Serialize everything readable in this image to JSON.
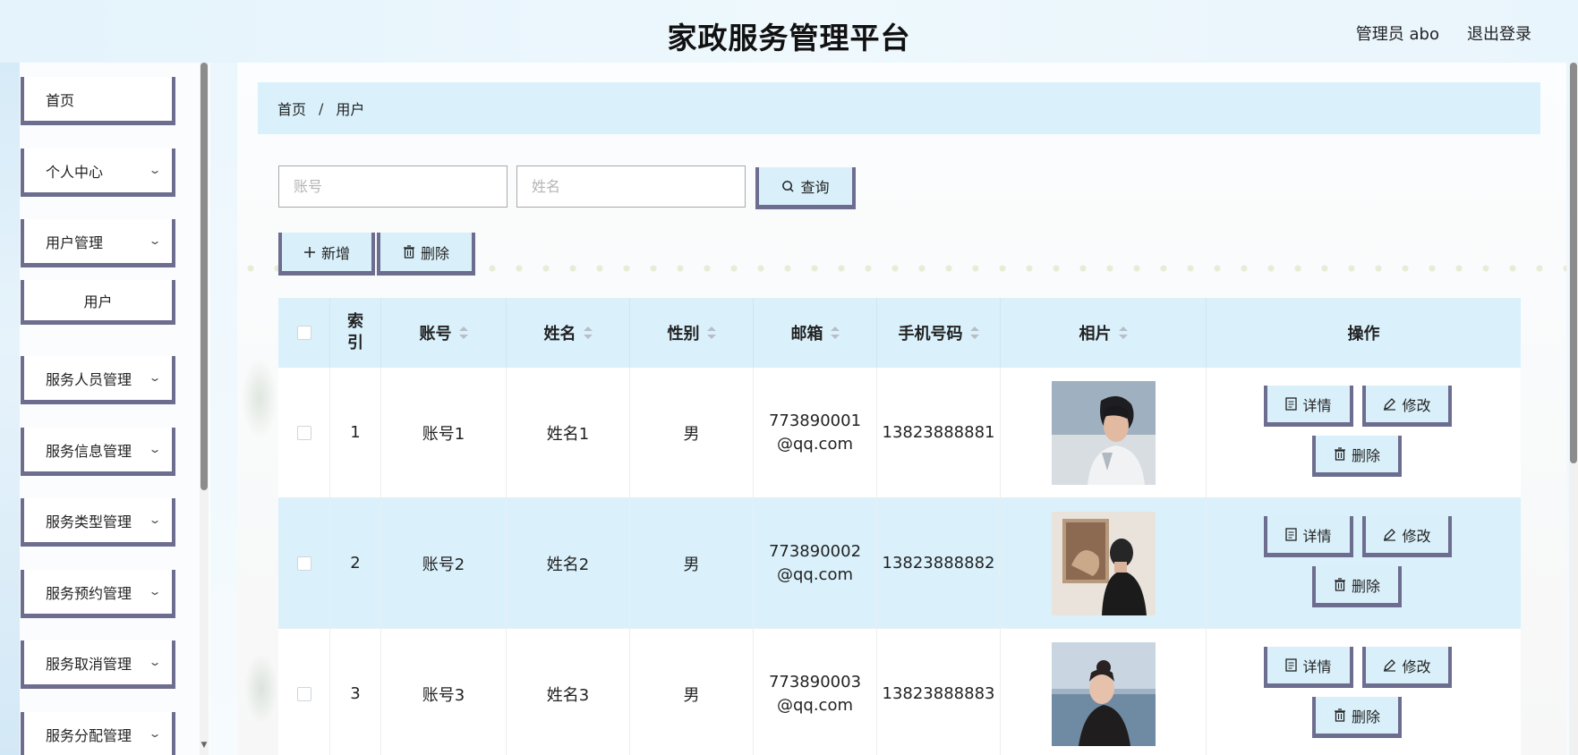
{
  "header": {
    "title": "家政服务管理平台",
    "user": "管理员 abo",
    "logout": "退出登录"
  },
  "sidebar": {
    "items": [
      {
        "label": "首页",
        "expandable": false
      },
      {
        "label": "个人中心",
        "expandable": true
      },
      {
        "label": "用户管理",
        "expandable": true
      },
      {
        "label": "用户",
        "expandable": false,
        "sub": true
      },
      {
        "label": "服务人员管理",
        "expandable": true
      },
      {
        "label": "服务信息管理",
        "expandable": true
      },
      {
        "label": "服务类型管理",
        "expandable": true
      },
      {
        "label": "服务预约管理",
        "expandable": true
      },
      {
        "label": "服务取消管理",
        "expandable": true
      },
      {
        "label": "服务分配管理",
        "expandable": true
      }
    ]
  },
  "breadcrumb": {
    "home": "首页",
    "separator": "/",
    "current": "用户"
  },
  "search": {
    "account_placeholder": "账号",
    "name_placeholder": "姓名",
    "query_label": "查询"
  },
  "actions": {
    "add_label": "新增",
    "delete_label": "删除"
  },
  "table": {
    "headers": {
      "index": "索引",
      "account": "账号",
      "name": "姓名",
      "gender": "性别",
      "email": "邮箱",
      "phone": "手机号码",
      "photo": "相片",
      "ops": "操作"
    },
    "rows": [
      {
        "index": "1",
        "account": "账号1",
        "name": "姓名1",
        "gender": "男",
        "email": "773890001@qq.com",
        "phone": "13823888881"
      },
      {
        "index": "2",
        "account": "账号2",
        "name": "姓名2",
        "gender": "男",
        "email": "773890002@qq.com",
        "phone": "13823888882"
      },
      {
        "index": "3",
        "account": "账号3",
        "name": "姓名3",
        "gender": "男",
        "email": "773890003@qq.com",
        "phone": "13823888883"
      }
    ],
    "row_actions": {
      "detail": "详情",
      "edit": "修改",
      "delete": "删除"
    }
  },
  "colors": {
    "accent_border": "#6d6d8f",
    "highlight_bg": "#daf1fc"
  }
}
